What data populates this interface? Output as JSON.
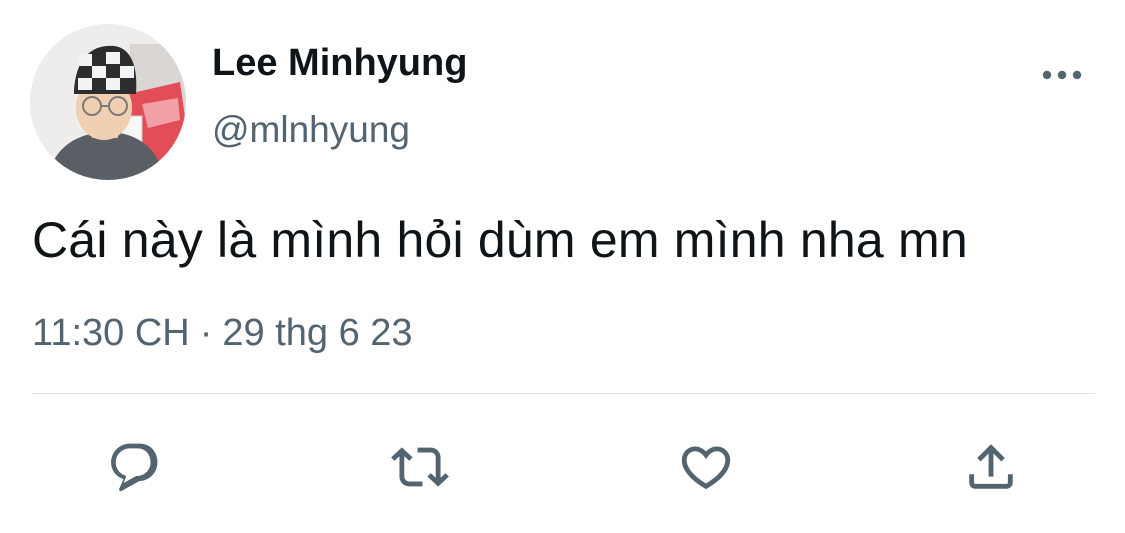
{
  "tweet": {
    "author_name": "Lee Minhyung",
    "author_handle": "@mlnhyung",
    "text": "Cái này là mình hỏi dùm em mình nha mn",
    "time": "11:30 CH",
    "separator": "·",
    "date": "29 thg 6 23"
  },
  "icons": {
    "more": "more-horizontal-icon",
    "reply": "reply-icon",
    "retweet": "retweet-icon",
    "like": "heart-icon",
    "share": "share-icon"
  },
  "colors": {
    "text_primary": "#0f1419",
    "text_secondary": "#536471",
    "icon": "#536471",
    "divider": "#dfe3e6"
  }
}
